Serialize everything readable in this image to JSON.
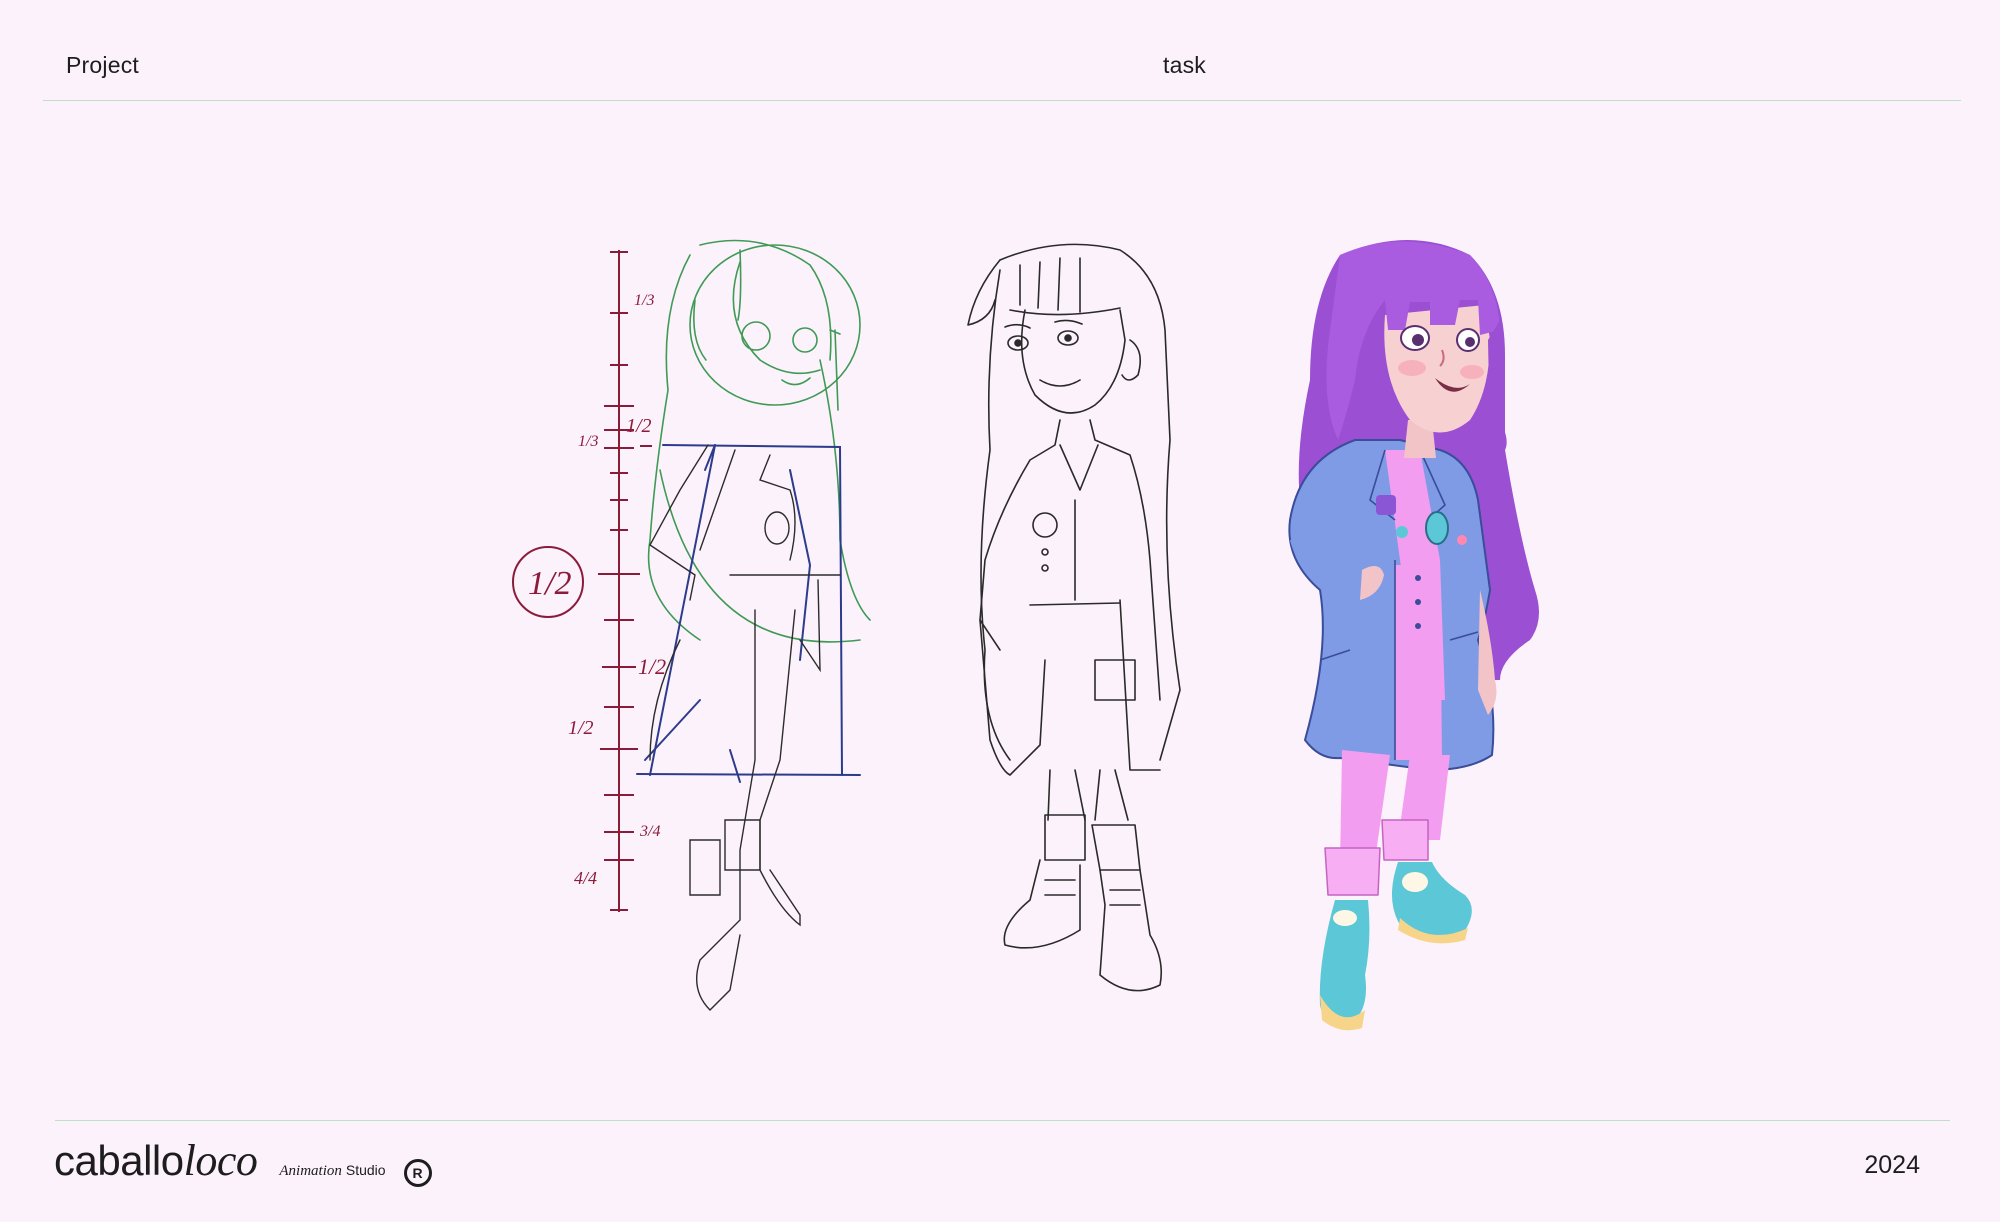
{
  "header": {
    "project": "Project",
    "task": "task"
  },
  "footer": {
    "logo_word": "caballo",
    "logo_italic": "loco",
    "logo_tag_italic": "Animation",
    "logo_tag": "Studio",
    "reg": "R",
    "year": "2024"
  },
  "sketch": {
    "marks": [
      "1/3",
      "1/2",
      "1/3",
      "1/2",
      "1/2",
      "1/2",
      "3/4",
      "4/4"
    ]
  },
  "colors": {
    "background": "#fcf2fb",
    "rule": "#bfe0c4",
    "measure": "#8a1c3a",
    "construction_green": "#3f9a55",
    "construction_blue": "#2c3b8c",
    "hair": "#9b4fd3",
    "coat": "#7f9be6",
    "outfit": "#f39df0",
    "shoe": "#5cc7d6"
  }
}
